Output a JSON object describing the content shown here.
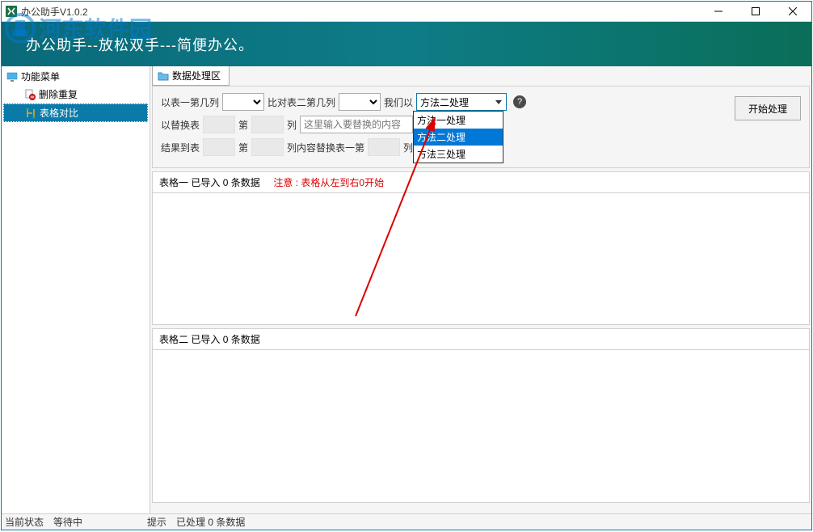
{
  "titlebar": {
    "title": "办公助手V1.0.2"
  },
  "watermark": {
    "text": "河东软件园"
  },
  "banner": {
    "text": "办公助手--放松双手---简便办公。"
  },
  "sidebar": {
    "root": "功能菜单",
    "items": [
      {
        "label": "删除重复"
      },
      {
        "label": "表格对比"
      }
    ]
  },
  "tab": {
    "label": "数据处理区"
  },
  "config": {
    "row1": {
      "label1": "以表一第几列",
      "label2": "比对表二第几列",
      "label3": "我们以",
      "method_selected": "方法二处理"
    },
    "row2": {
      "label1": "以替换表",
      "label2": "第",
      "label3": "列",
      "placeholder": "这里输入要替换的内容"
    },
    "row3": {
      "label1": "结果到表",
      "label2": "第",
      "label3": "列内容替换表一第",
      "label4": "列内容"
    },
    "start_button": "开始处理"
  },
  "dropdown": {
    "options": [
      {
        "label": "方法一处理"
      },
      {
        "label": "方法二处理"
      },
      {
        "label": "方法三处理"
      }
    ]
  },
  "table1": {
    "title_prefix": "表格一   已导入",
    "count": "0",
    "title_suffix": "条数据",
    "note": "注意 : 表格从左到右0开始"
  },
  "table2": {
    "title_prefix": "表格二   已导入",
    "count": "0",
    "title_suffix": "条数据"
  },
  "statusbar": {
    "status_label": "当前状态",
    "status_value": "等待中",
    "tip_label": "提示",
    "tip_value": "已处理 0 条数据"
  },
  "help_icon": "?"
}
